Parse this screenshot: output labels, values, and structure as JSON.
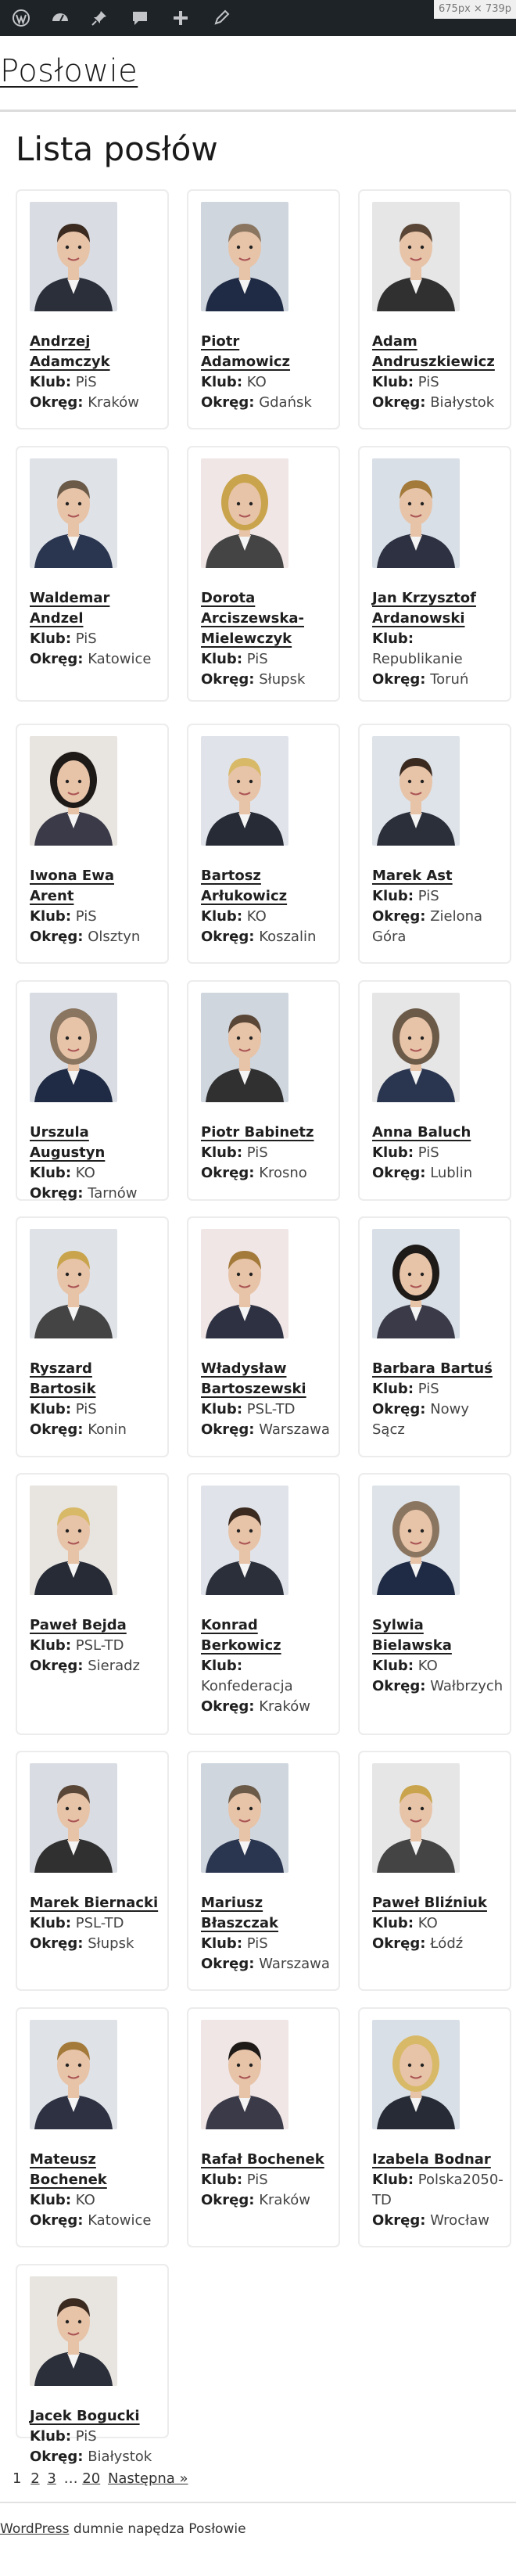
{
  "adminbar": {
    "icons": [
      "wordpress-icon",
      "dashboard-icon",
      "pin-icon",
      "comments-icon",
      "plus-icon",
      "edit-icon"
    ],
    "viewport_size": "675px × 739p"
  },
  "site": {
    "title": "Posłowie"
  },
  "page": {
    "heading": "Lista posłów"
  },
  "labels": {
    "klub": "Klub:",
    "okreg": "Okręg:"
  },
  "members": [
    {
      "name": "Andrzej Adamczyk",
      "klub": "PiS",
      "okreg": "Kraków"
    },
    {
      "name": "Piotr Adamowicz",
      "klub": "KO",
      "okreg": "Gdańsk"
    },
    {
      "name": "Adam Andruszkiewicz",
      "klub": "PiS",
      "okreg": "Białystok"
    },
    {
      "name": "Waldemar Andzel",
      "klub": "PiS",
      "okreg": "Katowice"
    },
    {
      "name": "Dorota Arciszewska-Mielewczyk",
      "klub": "PiS",
      "okreg": "Słupsk"
    },
    {
      "name": "Jan Krzysztof Ardanowski",
      "klub": "Republikanie",
      "okreg": "Toruń"
    },
    {
      "name": "Iwona Ewa Arent",
      "klub": "PiS",
      "okreg": "Olsztyn"
    },
    {
      "name": "Bartosz Arłukowicz",
      "klub": "KO",
      "okreg": "Koszalin"
    },
    {
      "name": "Marek Ast",
      "klub": "PiS",
      "okreg": "Zielona Góra"
    },
    {
      "name": "Urszula Augustyn",
      "klub": "KO",
      "okreg": "Tarnów"
    },
    {
      "name": "Piotr Babinetz",
      "klub": "PiS",
      "okreg": "Krosno"
    },
    {
      "name": "Anna Baluch",
      "klub": "PiS",
      "okreg": "Lublin"
    },
    {
      "name": "Ryszard Bartosik",
      "klub": "PiS",
      "okreg": "Konin"
    },
    {
      "name": "Władysław Bartoszewski",
      "klub": "PSL-TD",
      "okreg": "Warszawa"
    },
    {
      "name": "Barbara Bartuś",
      "klub": "PiS",
      "okreg": "Nowy Sącz"
    },
    {
      "name": "Paweł Bejda",
      "klub": "PSL-TD",
      "okreg": "Sieradz"
    },
    {
      "name": "Konrad Berkowicz",
      "klub": "Konfederacja",
      "okreg": "Kraków"
    },
    {
      "name": "Sylwia Bielawska",
      "klub": "KO",
      "okreg": "Wałbrzych"
    },
    {
      "name": "Marek Biernacki",
      "klub": "PSL-TD",
      "okreg": "Słupsk"
    },
    {
      "name": "Mariusz Błaszczak",
      "klub": "PiS",
      "okreg": "Warszawa"
    },
    {
      "name": "Paweł Bliźniuk",
      "klub": "KO",
      "okreg": "Łódź"
    },
    {
      "name": "Mateusz Bochenek",
      "klub": "KO",
      "okreg": "Katowice"
    },
    {
      "name": "Rafał Bochenek",
      "klub": "PiS",
      "okreg": "Kraków"
    },
    {
      "name": "Izabela Bodnar",
      "klub": "Polska2050-TD",
      "okreg": "Wrocław"
    },
    {
      "name": "Jacek Bogucki",
      "klub": "PiS",
      "okreg": "Białystok"
    }
  ],
  "pagination": {
    "current": "1",
    "pages": [
      "2",
      "3"
    ],
    "ellipsis": "…",
    "last": "20",
    "next": "Następna »"
  },
  "footer": {
    "link": "WordPress",
    "text": " dumnie napędza Posłowie"
  }
}
